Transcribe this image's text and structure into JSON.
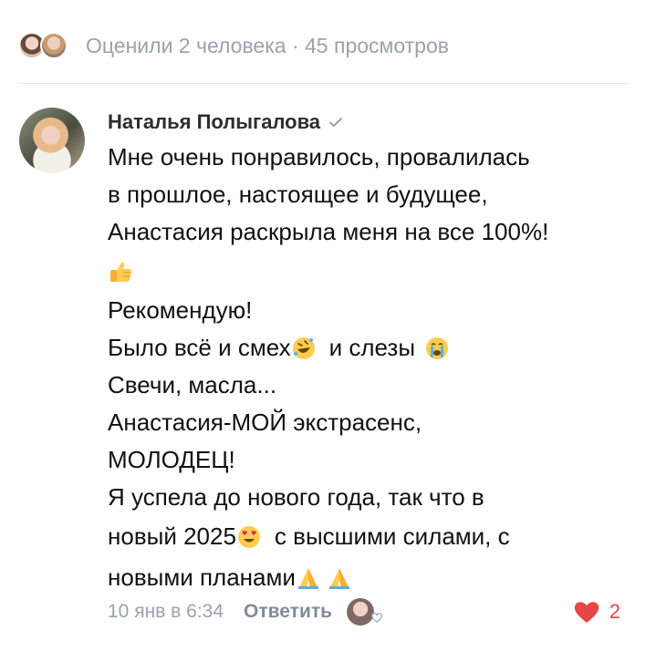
{
  "likes_bar": {
    "text": "Оценили 2 человека · 45 просмотров"
  },
  "comment": {
    "author": "Наталья Полыгалова",
    "lines": [
      "Мне очень понравилось,  провалилась",
      "в прошлое, настоящее и будущее,",
      "Анастасия раскрыла меня на все 100%!",
      "",
      "Рекомендую!",
      "Было всё и смех",
      "и слезы",
      "Свечи, масла...",
      "Анастасия-МОЙ экстрасенс,",
      "МОЛОДЕЦ!",
      "Я успела до нового года,  так что в",
      "новый 2025",
      "с высшими силами, с",
      "новыми планами"
    ],
    "emojis": {
      "thumbs_up": "thumbs-up-emoji",
      "laughing": "rolling-laughing-emoji",
      "crying": "loudly-crying-emoji",
      "heart_eyes": "heart-eyes-emoji",
      "praying": "folded-hands-emoji"
    },
    "date": "10 янв в 6:34",
    "reply_label": "Ответить",
    "like_count": "2"
  },
  "colors": {
    "muted": "#99a2ad",
    "reply": "#818c99",
    "like_red": "#e64646",
    "emoji_yellow": "#ffcc4d"
  }
}
